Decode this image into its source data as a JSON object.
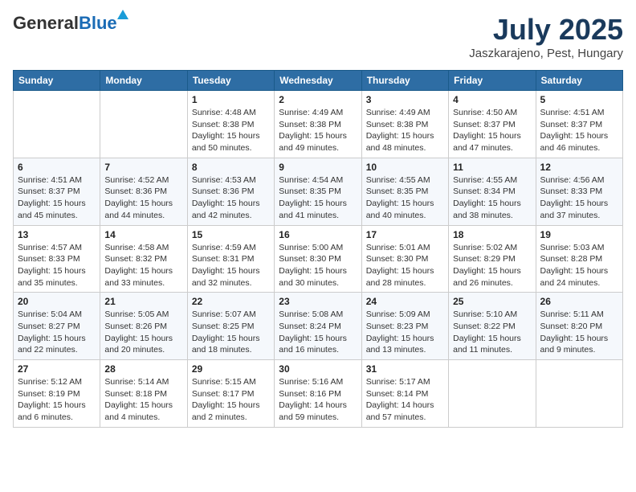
{
  "header": {
    "logo_general": "General",
    "logo_blue": "Blue",
    "title_month": "July 2025",
    "title_location": "Jaszkarajeno, Pest, Hungary"
  },
  "days_of_week": [
    "Sunday",
    "Monday",
    "Tuesday",
    "Wednesday",
    "Thursday",
    "Friday",
    "Saturday"
  ],
  "weeks": [
    [
      {
        "day": "",
        "sunrise": "",
        "sunset": "",
        "daylight": ""
      },
      {
        "day": "",
        "sunrise": "",
        "sunset": "",
        "daylight": ""
      },
      {
        "day": "1",
        "sunrise": "Sunrise: 4:48 AM",
        "sunset": "Sunset: 8:38 PM",
        "daylight": "Daylight: 15 hours and 50 minutes."
      },
      {
        "day": "2",
        "sunrise": "Sunrise: 4:49 AM",
        "sunset": "Sunset: 8:38 PM",
        "daylight": "Daylight: 15 hours and 49 minutes."
      },
      {
        "day": "3",
        "sunrise": "Sunrise: 4:49 AM",
        "sunset": "Sunset: 8:38 PM",
        "daylight": "Daylight: 15 hours and 48 minutes."
      },
      {
        "day": "4",
        "sunrise": "Sunrise: 4:50 AM",
        "sunset": "Sunset: 8:37 PM",
        "daylight": "Daylight: 15 hours and 47 minutes."
      },
      {
        "day": "5",
        "sunrise": "Sunrise: 4:51 AM",
        "sunset": "Sunset: 8:37 PM",
        "daylight": "Daylight: 15 hours and 46 minutes."
      }
    ],
    [
      {
        "day": "6",
        "sunrise": "Sunrise: 4:51 AM",
        "sunset": "Sunset: 8:37 PM",
        "daylight": "Daylight: 15 hours and 45 minutes."
      },
      {
        "day": "7",
        "sunrise": "Sunrise: 4:52 AM",
        "sunset": "Sunset: 8:36 PM",
        "daylight": "Daylight: 15 hours and 44 minutes."
      },
      {
        "day": "8",
        "sunrise": "Sunrise: 4:53 AM",
        "sunset": "Sunset: 8:36 PM",
        "daylight": "Daylight: 15 hours and 42 minutes."
      },
      {
        "day": "9",
        "sunrise": "Sunrise: 4:54 AM",
        "sunset": "Sunset: 8:35 PM",
        "daylight": "Daylight: 15 hours and 41 minutes."
      },
      {
        "day": "10",
        "sunrise": "Sunrise: 4:55 AM",
        "sunset": "Sunset: 8:35 PM",
        "daylight": "Daylight: 15 hours and 40 minutes."
      },
      {
        "day": "11",
        "sunrise": "Sunrise: 4:55 AM",
        "sunset": "Sunset: 8:34 PM",
        "daylight": "Daylight: 15 hours and 38 minutes."
      },
      {
        "day": "12",
        "sunrise": "Sunrise: 4:56 AM",
        "sunset": "Sunset: 8:33 PM",
        "daylight": "Daylight: 15 hours and 37 minutes."
      }
    ],
    [
      {
        "day": "13",
        "sunrise": "Sunrise: 4:57 AM",
        "sunset": "Sunset: 8:33 PM",
        "daylight": "Daylight: 15 hours and 35 minutes."
      },
      {
        "day": "14",
        "sunrise": "Sunrise: 4:58 AM",
        "sunset": "Sunset: 8:32 PM",
        "daylight": "Daylight: 15 hours and 33 minutes."
      },
      {
        "day": "15",
        "sunrise": "Sunrise: 4:59 AM",
        "sunset": "Sunset: 8:31 PM",
        "daylight": "Daylight: 15 hours and 32 minutes."
      },
      {
        "day": "16",
        "sunrise": "Sunrise: 5:00 AM",
        "sunset": "Sunset: 8:30 PM",
        "daylight": "Daylight: 15 hours and 30 minutes."
      },
      {
        "day": "17",
        "sunrise": "Sunrise: 5:01 AM",
        "sunset": "Sunset: 8:30 PM",
        "daylight": "Daylight: 15 hours and 28 minutes."
      },
      {
        "day": "18",
        "sunrise": "Sunrise: 5:02 AM",
        "sunset": "Sunset: 8:29 PM",
        "daylight": "Daylight: 15 hours and 26 minutes."
      },
      {
        "day": "19",
        "sunrise": "Sunrise: 5:03 AM",
        "sunset": "Sunset: 8:28 PM",
        "daylight": "Daylight: 15 hours and 24 minutes."
      }
    ],
    [
      {
        "day": "20",
        "sunrise": "Sunrise: 5:04 AM",
        "sunset": "Sunset: 8:27 PM",
        "daylight": "Daylight: 15 hours and 22 minutes."
      },
      {
        "day": "21",
        "sunrise": "Sunrise: 5:05 AM",
        "sunset": "Sunset: 8:26 PM",
        "daylight": "Daylight: 15 hours and 20 minutes."
      },
      {
        "day": "22",
        "sunrise": "Sunrise: 5:07 AM",
        "sunset": "Sunset: 8:25 PM",
        "daylight": "Daylight: 15 hours and 18 minutes."
      },
      {
        "day": "23",
        "sunrise": "Sunrise: 5:08 AM",
        "sunset": "Sunset: 8:24 PM",
        "daylight": "Daylight: 15 hours and 16 minutes."
      },
      {
        "day": "24",
        "sunrise": "Sunrise: 5:09 AM",
        "sunset": "Sunset: 8:23 PM",
        "daylight": "Daylight: 15 hours and 13 minutes."
      },
      {
        "day": "25",
        "sunrise": "Sunrise: 5:10 AM",
        "sunset": "Sunset: 8:22 PM",
        "daylight": "Daylight: 15 hours and 11 minutes."
      },
      {
        "day": "26",
        "sunrise": "Sunrise: 5:11 AM",
        "sunset": "Sunset: 8:20 PM",
        "daylight": "Daylight: 15 hours and 9 minutes."
      }
    ],
    [
      {
        "day": "27",
        "sunrise": "Sunrise: 5:12 AM",
        "sunset": "Sunset: 8:19 PM",
        "daylight": "Daylight: 15 hours and 6 minutes."
      },
      {
        "day": "28",
        "sunrise": "Sunrise: 5:14 AM",
        "sunset": "Sunset: 8:18 PM",
        "daylight": "Daylight: 15 hours and 4 minutes."
      },
      {
        "day": "29",
        "sunrise": "Sunrise: 5:15 AM",
        "sunset": "Sunset: 8:17 PM",
        "daylight": "Daylight: 15 hours and 2 minutes."
      },
      {
        "day": "30",
        "sunrise": "Sunrise: 5:16 AM",
        "sunset": "Sunset: 8:16 PM",
        "daylight": "Daylight: 14 hours and 59 minutes."
      },
      {
        "day": "31",
        "sunrise": "Sunrise: 5:17 AM",
        "sunset": "Sunset: 8:14 PM",
        "daylight": "Daylight: 14 hours and 57 minutes."
      },
      {
        "day": "",
        "sunrise": "",
        "sunset": "",
        "daylight": ""
      },
      {
        "day": "",
        "sunrise": "",
        "sunset": "",
        "daylight": ""
      }
    ]
  ]
}
